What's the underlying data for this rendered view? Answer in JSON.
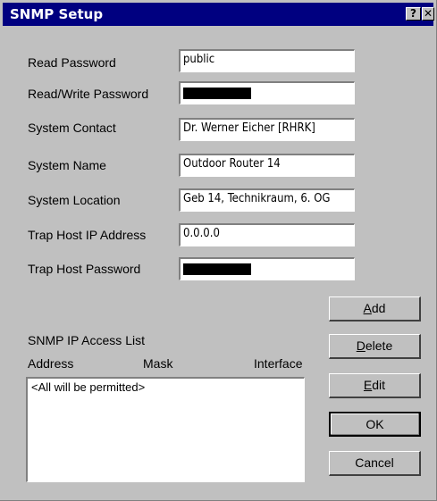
{
  "window": {
    "title": "SNMP Setup",
    "help_label": "?",
    "close_label": "✕"
  },
  "fields": [
    {
      "label": "Read Password",
      "value": "public",
      "masked": false
    },
    {
      "label": "Read/Write Password",
      "value": "",
      "masked": true
    },
    {
      "label": "System Contact",
      "value": "Dr. Werner Eicher [RHRK]",
      "masked": false
    },
    {
      "label": "System Name",
      "value": "Outdoor Router 14",
      "masked": false
    },
    {
      "label": "System Location",
      "value": "Geb 14, Technikraum, 6. OG",
      "masked": false
    },
    {
      "label": "Trap Host IP Address",
      "value": "0.0.0.0",
      "masked": false
    },
    {
      "label": "Trap Host Password",
      "value": "",
      "masked": true
    }
  ],
  "access_list": {
    "title": "SNMP IP Access List",
    "columns": [
      "Address",
      "Mask",
      "Interface"
    ],
    "items": [
      "<All will be permitted>"
    ]
  },
  "buttons": {
    "add": {
      "accel": "A",
      "rest": "dd"
    },
    "delete": {
      "accel": "D",
      "rest": "elete"
    },
    "edit": {
      "accel": "E",
      "rest": "dit"
    },
    "ok": "OK",
    "cancel": "Cancel"
  }
}
